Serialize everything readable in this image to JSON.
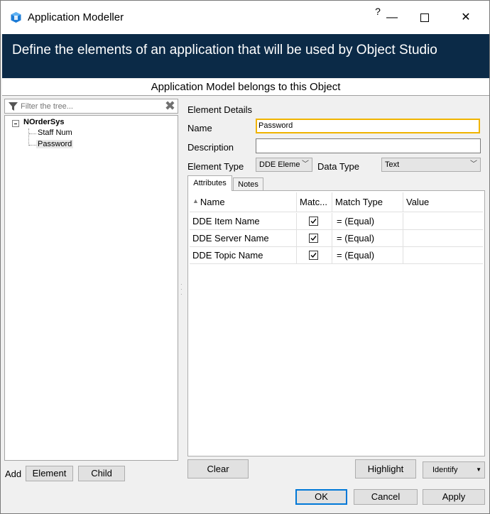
{
  "window": {
    "title": "Application Modeller",
    "help_label": "?",
    "minimize_label": "—",
    "close_label": "✕"
  },
  "banner": {
    "text": "Define the elements of an application that will be used by Object Studio"
  },
  "belongs_bar": {
    "text": "Application Model belongs to this Object"
  },
  "tree": {
    "filter_placeholder": "Filter the tree...",
    "root": "NOrderSys",
    "items": [
      {
        "label": "Staff Num",
        "selected": false
      },
      {
        "label": "Password",
        "selected": true
      }
    ]
  },
  "add_row": {
    "label": "Add",
    "element_button": "Element",
    "child_button": "Child"
  },
  "details": {
    "title": "Element Details",
    "name_label": "Name",
    "name_value": "Password",
    "description_label": "Description",
    "description_value": "",
    "element_type_label": "Element Type",
    "element_type_value": "DDE Eleme",
    "data_type_label": "Data Type",
    "data_type_value": "Text"
  },
  "tabs": [
    {
      "label": "Attributes",
      "active": true
    },
    {
      "label": "Notes",
      "active": false
    }
  ],
  "attributes_grid": {
    "columns": [
      "Name",
      "Matc...",
      "Match Type",
      "Value"
    ],
    "rows": [
      {
        "name": "DDE Item Name",
        "match": true,
        "match_type": "=  (Equal)",
        "value": ""
      },
      {
        "name": "DDE Server Name",
        "match": true,
        "match_type": "=  (Equal)",
        "value": ""
      },
      {
        "name": "DDE Topic Name",
        "match": true,
        "match_type": "=  (Equal)",
        "value": ""
      }
    ]
  },
  "buttons": {
    "clear": "Clear",
    "highlight": "Highlight",
    "identify": "Identify",
    "ok": "OK",
    "cancel": "Cancel",
    "apply": "Apply"
  },
  "colors": {
    "banner_bg": "#0b2a47",
    "focus_border": "#f0b400",
    "default_button_border": "#0078d7"
  }
}
